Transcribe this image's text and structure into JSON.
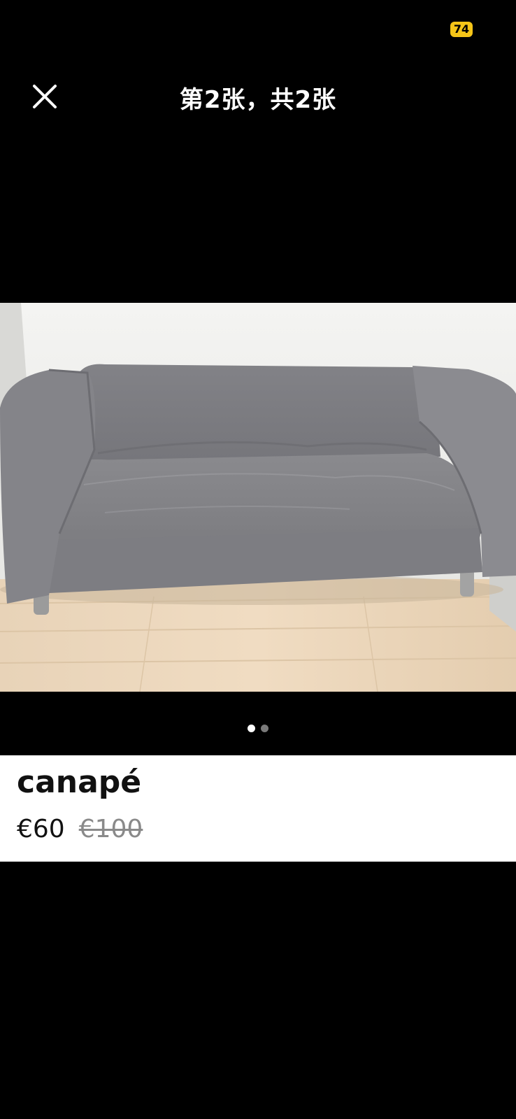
{
  "status": {
    "battery_badge": "74"
  },
  "viewer": {
    "title": "第2张，共2张",
    "close_icon": "close-icon",
    "pagination": {
      "total": 2,
      "active_index": 0
    }
  },
  "photo": {
    "subject": "sofa-photo"
  },
  "listing": {
    "title": "canapé",
    "price": "€60",
    "original_price": "€100"
  },
  "colors": {
    "background": "#000000",
    "badge": "#f5c518",
    "card": "#ffffff",
    "strikethrough_price": "#8a8a8a"
  }
}
